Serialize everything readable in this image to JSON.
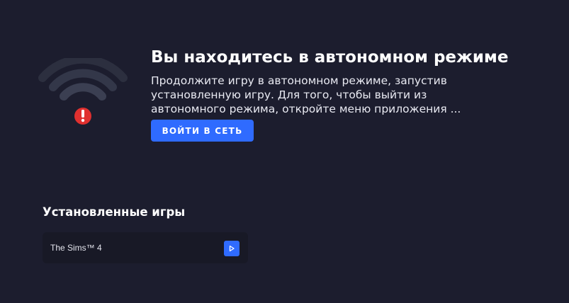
{
  "offline": {
    "icon": "wifi-offline-icon",
    "title": "Вы находитесь в автономном режиме",
    "description": "Продолжите игру в автономном режиме, запустив установленную игру. Для того, чтобы выйти из автономного режима, откройте меню приложения ...",
    "connect_label": "ВОЙТИ В СЕТЬ",
    "accent_color": "#2f6bff",
    "alert_color": "#e0302f"
  },
  "installed": {
    "title": "Установленные игры",
    "games": [
      {
        "name": "The Sims™ 4",
        "action_icon": "play-icon"
      }
    ]
  }
}
